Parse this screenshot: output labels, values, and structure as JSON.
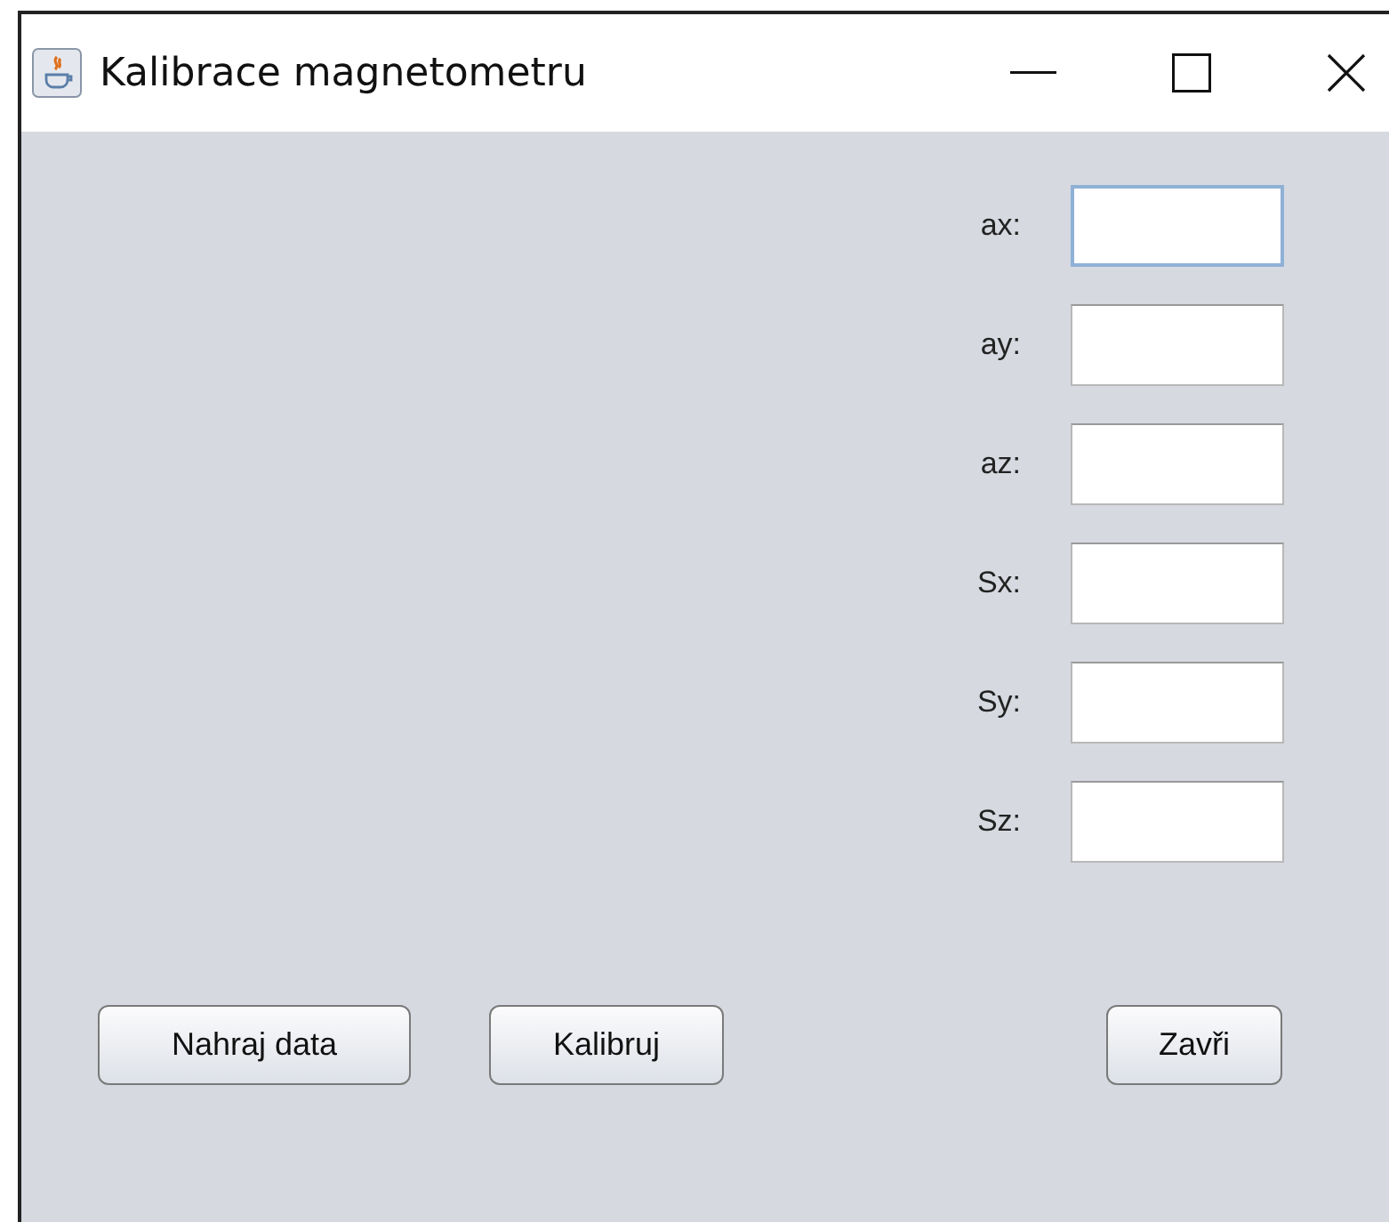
{
  "window": {
    "title": "Kalibrace magnetometru"
  },
  "fields": [
    {
      "label": "ax:",
      "focused": true
    },
    {
      "label": "ay:",
      "focused": false
    },
    {
      "label": "az:",
      "focused": false
    },
    {
      "label": "Sx:",
      "focused": false
    },
    {
      "label": "Sy:",
      "focused": false
    },
    {
      "label": "Sz:",
      "focused": false
    }
  ],
  "buttons": [
    {
      "label": "Nahraj data"
    },
    {
      "label": "Kalibruj"
    },
    {
      "label": "Zavři"
    }
  ]
}
